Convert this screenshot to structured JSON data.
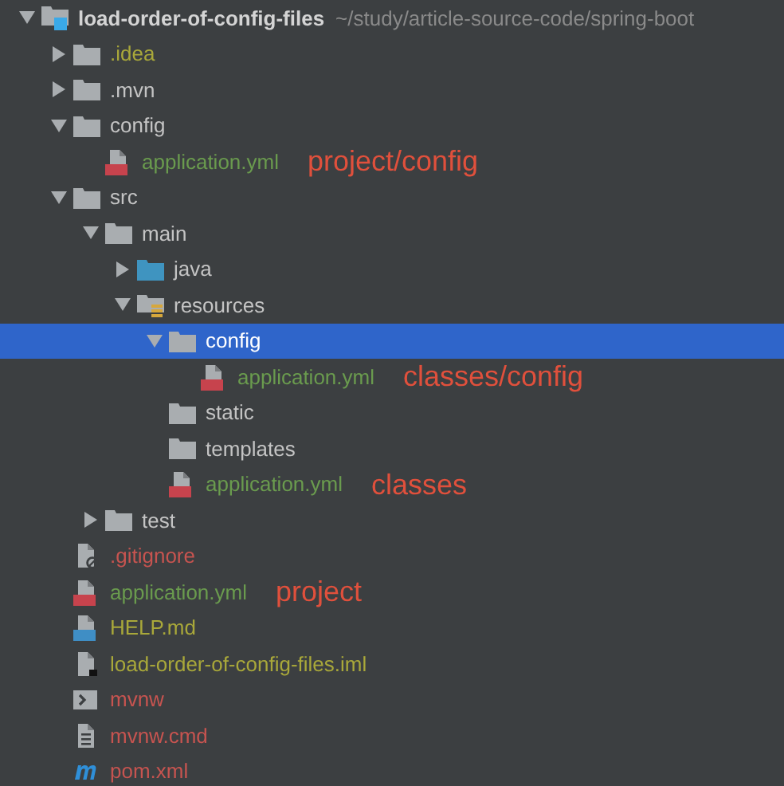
{
  "tree": [
    {
      "name": "load-order-of-config-files",
      "path": "~/study/article-source-code/spring-boot",
      "kind": "module",
      "expanded": true,
      "selected": false,
      "color": "#d4d4d4",
      "children": [
        {
          "name": ".idea",
          "kind": "folder",
          "expanded": false,
          "selected": false,
          "color": "#a9a83a"
        },
        {
          "name": ".mvn",
          "kind": "folder",
          "expanded": false,
          "selected": false,
          "color": "#c4c4c4"
        },
        {
          "name": "config",
          "kind": "folder",
          "expanded": true,
          "selected": false,
          "color": "#c4c4c4",
          "children": [
            {
              "name": "application.yml",
              "kind": "yml",
              "selected": false,
              "color": "#6a9b4e",
              "note": "project/config"
            }
          ]
        },
        {
          "name": "src",
          "kind": "folder",
          "expanded": true,
          "selected": false,
          "color": "#c4c4c4",
          "children": [
            {
              "name": "main",
              "kind": "folder",
              "expanded": true,
              "selected": false,
              "color": "#c4c4c4",
              "children": [
                {
                  "name": "java",
                  "kind": "source",
                  "expanded": false,
                  "selected": false,
                  "color": "#c4c4c4"
                },
                {
                  "name": "resources",
                  "kind": "resources",
                  "expanded": true,
                  "selected": false,
                  "color": "#c4c4c4",
                  "children": [
                    {
                      "name": "config",
                      "kind": "folder",
                      "expanded": true,
                      "selected": true,
                      "color": "#ffffff",
                      "children": [
                        {
                          "name": "application.yml",
                          "kind": "yml",
                          "selected": false,
                          "color": "#6a9b4e",
                          "note": "classes/config"
                        }
                      ]
                    },
                    {
                      "name": "static",
                      "kind": "folder",
                      "selected": false,
                      "color": "#c4c4c4"
                    },
                    {
                      "name": "templates",
                      "kind": "folder",
                      "selected": false,
                      "color": "#c4c4c4"
                    },
                    {
                      "name": "application.yml",
                      "kind": "yml",
                      "selected": false,
                      "color": "#6a9b4e",
                      "note": "classes"
                    }
                  ]
                }
              ]
            },
            {
              "name": "test",
              "kind": "folder",
              "expanded": false,
              "selected": false,
              "color": "#c4c4c4"
            }
          ]
        },
        {
          "name": ".gitignore",
          "kind": "gitignore",
          "selected": false,
          "color": "#c75450"
        },
        {
          "name": "application.yml",
          "kind": "yml",
          "selected": false,
          "color": "#6a9b4e",
          "note": "project"
        },
        {
          "name": "HELP.md",
          "kind": "md",
          "selected": false,
          "color": "#a9a83a"
        },
        {
          "name": "load-order-of-config-files.iml",
          "kind": "iml",
          "selected": false,
          "color": "#a9a83a"
        },
        {
          "name": "mvnw",
          "kind": "script",
          "selected": false,
          "color": "#c75450"
        },
        {
          "name": "mvnw.cmd",
          "kind": "text",
          "selected": false,
          "color": "#c75450"
        },
        {
          "name": "pom.xml",
          "kind": "maven",
          "selected": false,
          "color": "#c75450"
        }
      ]
    }
  ]
}
